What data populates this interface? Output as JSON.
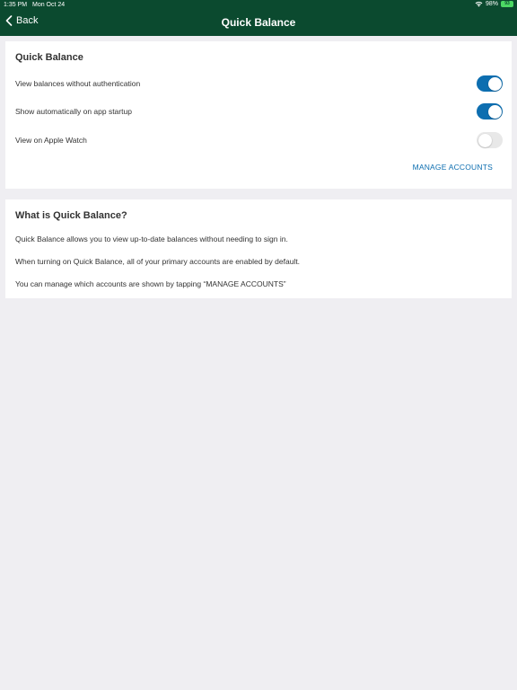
{
  "status_bar": {
    "time": "1:35 PM",
    "date": "Mon Oct 24",
    "battery_percent": "98%",
    "battery_icon_label": "93"
  },
  "nav": {
    "back_label": "Back",
    "title": "Quick Balance"
  },
  "settings_card": {
    "title": "Quick Balance",
    "rows": [
      {
        "label": "View balances without authentication",
        "toggle": true
      },
      {
        "label": "Show automatically on app startup",
        "toggle": true
      },
      {
        "label": "View on Apple Watch",
        "toggle": false
      }
    ],
    "manage_accounts": "MANAGE ACCOUNTS"
  },
  "info_card": {
    "title": "What is Quick Balance?",
    "paragraphs": [
      "Quick Balance allows you to view up-to-date balances without needing to sign in.",
      "When turning on Quick Balance, all of your primary accounts are enabled by default.",
      "You can manage which accounts are shown by tapping “MANAGE ACCOUNTS”"
    ]
  },
  "colors": {
    "header": "#0b4a2f",
    "toggle_on": "#0d6eb0",
    "link": "#0d6eb0",
    "background": "#efeef2"
  }
}
